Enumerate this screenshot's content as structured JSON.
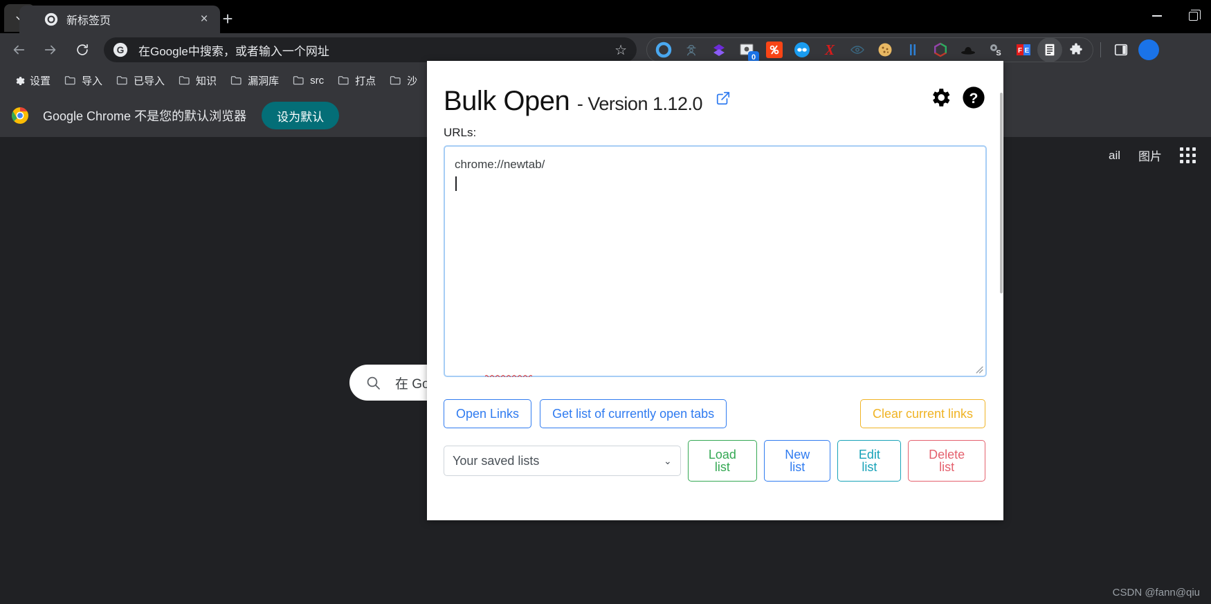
{
  "browser": {
    "tab": {
      "title": "新标签页",
      "favicon": "chrome-icon",
      "close": "×"
    },
    "newtab_button": "+",
    "tab_search": "chevron-down-icon",
    "window_controls": {
      "minimize": "minimize-icon",
      "restore": "restore-icon"
    },
    "omnibox": {
      "placeholder": "在Google中搜索，或者输入一个网址",
      "value": "",
      "search_engine_icon": "google-g-icon",
      "bookmark_star": "star-icon"
    },
    "nav": {
      "back": "back-arrow-icon",
      "forward": "forward-arrow-icon",
      "reload": "reload-icon"
    },
    "extension_icons": [
      "ring-blue-icon",
      "detective-icon",
      "diamond-purple-icon",
      "screenshot-badge-icon",
      "percent-orange-icon",
      "mask-blue-icon",
      "x-red-icon",
      "eye-outline-icon",
      "cookie-icon",
      "pause-bars-icon",
      "hexagon-color-icon",
      "bowler-hat-icon",
      "gears-s-icon",
      "fe-red-blue-icon",
      "reading-list-icon",
      "extensions-puzzle-icon"
    ],
    "side_panel_icon": "side-panel-icon",
    "profile_avatar": "avatar",
    "bookmarks": [
      {
        "label": "设置",
        "icon": "gear-icon"
      },
      {
        "label": "导入",
        "icon": "folder-icon"
      },
      {
        "label": "已导入",
        "icon": "folder-icon"
      },
      {
        "label": "知识",
        "icon": "folder-icon"
      },
      {
        "label": "漏洞库",
        "icon": "folder-icon"
      },
      {
        "label": "src",
        "icon": "folder-icon"
      },
      {
        "label": "打点",
        "icon": "folder-icon"
      },
      {
        "label": "沙",
        "icon": "folder-icon"
      }
    ],
    "infobar": {
      "icon": "chrome-logo",
      "message": "Google Chrome 不是您的默认浏览器",
      "button": "设为默认"
    }
  },
  "newtab_page": {
    "top_links": [
      "ail",
      "图片"
    ],
    "apps_icon": "apps-grid-icon",
    "search": {
      "icon": "search-icon",
      "placeholder": "在 Goo"
    },
    "watermark": "CSDN @fann@qiu"
  },
  "popup": {
    "title": "Bulk Open",
    "version_text": "- Version 1.12.0",
    "external_link_icon": "external-link-icon",
    "settings_icon": "gear-icon",
    "help_icon": "help-circle-icon",
    "urls_label": "URLs:",
    "urls_value": "chrome://newtab/",
    "resize_handle": "resize-grip-icon",
    "actions": {
      "open_links": "Open Links",
      "get_open_tabs": "Get list of currently open tabs",
      "clear_links": "Clear current links"
    },
    "lists": {
      "select_value": "Your saved lists",
      "select_chevron": "chevron-down-icon",
      "load": "Load list",
      "new": "New list",
      "edit": "Edit list",
      "delete": "Delete list"
    },
    "colors": {
      "blue": "#2f7bf0",
      "yellow": "#f0b323",
      "green": "#34a853",
      "teal": "#17a2b8",
      "red": "#e4606d",
      "focus_border": "#a6cdf5"
    }
  }
}
